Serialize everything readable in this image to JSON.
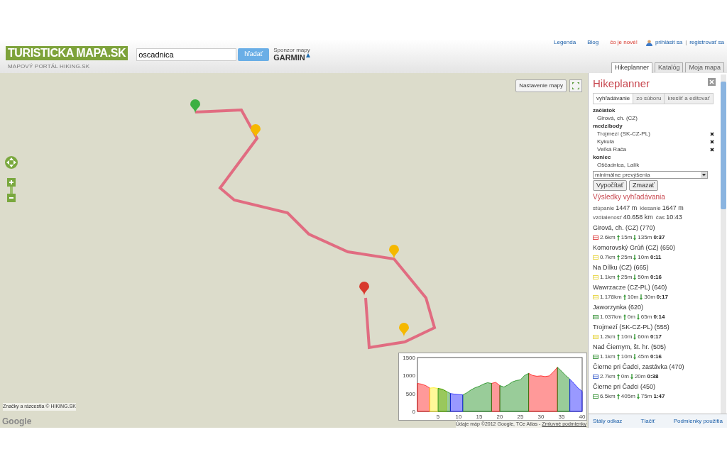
{
  "header": {
    "logo": "TURISTICKA MAPA.SK",
    "tagline": "MAPOVÝ PORTÁL HIKING.SK",
    "search": {
      "value": "oscadnica"
    },
    "search_button": "hľadať",
    "sponsor_label": "Sponzor mapy",
    "sponsor": "GARMIN",
    "links": [
      {
        "label": "Legenda",
        "kind": "plain"
      },
      {
        "label": "Blog",
        "kind": "plain"
      },
      {
        "label": "čo je nové!",
        "kind": "highlight"
      }
    ],
    "login": "prihlásit sa",
    "separator": "|",
    "register": "registrovať sa"
  },
  "tabs": [
    {
      "label": "Hikeplanner",
      "selected": true
    },
    {
      "label": "Katalóg",
      "selected": false
    },
    {
      "label": "Moja mapa",
      "selected": false
    }
  ],
  "map": {
    "settings_button": "Nastavenie mapy",
    "attribution_left": "Značky a rázcestia © HIKING.SK",
    "google": "Google",
    "attribution_right": "Údaje máp ©2012 Google, TCe Atlas - ",
    "terms_link": "Zmluvné podmienky",
    "markers": [
      {
        "color": "#3cb043"
      },
      {
        "color": "#f5b800"
      },
      {
        "color": "#f5b800"
      },
      {
        "color": "#d83a2e"
      },
      {
        "color": "#f5b800"
      }
    ],
    "chart_data": {
      "type": "area",
      "x": [
        0,
        1,
        2,
        3,
        4,
        5,
        6,
        7,
        8,
        9,
        10,
        11,
        12,
        13,
        14,
        15,
        16,
        17,
        18,
        19,
        20,
        21,
        22,
        23,
        24,
        25,
        26,
        27,
        28,
        29,
        30,
        31,
        32,
        33,
        34,
        35,
        36,
        37,
        38,
        39,
        40
      ],
      "xlim": [
        0,
        40
      ],
      "ylim": [
        0,
        1500
      ],
      "xticks": [
        5,
        10,
        15,
        20,
        25,
        30,
        35,
        40
      ],
      "yticks": [
        0,
        500,
        1000,
        1500
      ],
      "series": [
        {
          "color": "#ff0000",
          "values": [
            780,
            760,
            720,
            650,
            null,
            null,
            null,
            null,
            null,
            null,
            null,
            null,
            null,
            null,
            null,
            null,
            null,
            null,
            780,
            810,
            720,
            null,
            null,
            null,
            null,
            null,
            null,
            1060,
            1000,
            980,
            990,
            970,
            990,
            1100,
            1230,
            null,
            null,
            null,
            null,
            null,
            null
          ]
        },
        {
          "color": "#ffee00",
          "values": [
            null,
            null,
            null,
            650,
            660,
            640,
            620,
            560,
            null,
            null,
            null,
            null,
            null,
            null,
            null,
            null,
            null,
            null,
            null,
            null,
            null,
            null,
            null,
            null,
            null,
            null,
            null,
            null,
            null,
            null,
            null,
            null,
            null,
            null,
            null,
            null,
            null,
            null,
            null,
            null,
            null
          ]
        },
        {
          "color": "#008000",
          "values": [
            null,
            null,
            null,
            null,
            null,
            640,
            620,
            560,
            500,
            null,
            null,
            460,
            520,
            600,
            660,
            700,
            760,
            800,
            780,
            null,
            720,
            680,
            740,
            820,
            860,
            880,
            1000,
            1060,
            null,
            null,
            null,
            null,
            null,
            null,
            1230,
            1120,
            1000,
            900,
            null,
            null,
            null
          ]
        },
        {
          "color": "#0000ff",
          "values": [
            null,
            null,
            null,
            null,
            null,
            null,
            null,
            null,
            500,
            480,
            470,
            460,
            null,
            null,
            null,
            null,
            null,
            null,
            null,
            null,
            null,
            null,
            null,
            null,
            null,
            null,
            null,
            null,
            null,
            null,
            null,
            null,
            null,
            null,
            null,
            null,
            null,
            900,
            780,
            650,
            560
          ]
        }
      ]
    }
  },
  "planner": {
    "title": "Hikeplanner",
    "subtabs": [
      {
        "label": "vyhľadávanie",
        "selected": true
      },
      {
        "label": "zo súboru",
        "selected": false
      },
      {
        "label": "kresliť a editovať",
        "selected": false
      }
    ],
    "start_label": "začiatok",
    "start": "Girová, ch. (CZ)",
    "waypoints_label": "medzibody",
    "waypoints": [
      "Trojmezí (SK-CZ-PL)",
      "Kykula",
      "Veľká Rača"
    ],
    "end_label": "koniec",
    "end": "Oščadnica, Lalík",
    "mode": "minimálne prevýšenia",
    "calculate": "Vypočítať",
    "clear": "Zmazať",
    "results_title": "Výsledky vyhľadávania",
    "stats": [
      [
        {
          "label": "stúpanie",
          "value": "1447 m"
        },
        {
          "label": "klesanie",
          "value": "1647 m"
        }
      ],
      [
        {
          "label": "vzdialenosť",
          "value": "40.658 km"
        },
        {
          "label": "čas",
          "value": "10:43"
        }
      ]
    ],
    "legs": [
      {
        "name": "Girová, ch. (CZ) (770)",
        "color": "#e05050",
        "distance": "2.6km",
        "ascent": "15m",
        "descent": "135m",
        "time": "0:37"
      },
      {
        "name": "Komorovský Grúň (CZ) (650)",
        "color": "#e8d850",
        "distance": "0.7km",
        "ascent": "25m",
        "descent": "10m",
        "time": "0:11"
      },
      {
        "name": "Na Dílku (CZ) (665)",
        "color": "#e8d850",
        "distance": "1.1km",
        "ascent": "25m",
        "descent": "50m",
        "time": "0:16"
      },
      {
        "name": "Wawrzacze (CZ-PL) (640)",
        "color": "#e8d850",
        "distance": "1.178km",
        "ascent": "10m",
        "descent": "30m",
        "time": "0:17"
      },
      {
        "name": "Jaworzynka (620)",
        "color": "#50a050",
        "distance": "1.037km",
        "ascent": "0m",
        "descent": "65m",
        "time": "0:14"
      },
      {
        "name": "Trojmezí (SK-CZ-PL) (555)",
        "color": "#e8d850",
        "distance": "1.2km",
        "ascent": "10m",
        "descent": "60m",
        "time": "0:17"
      },
      {
        "name": "Nad Čiernym, št. hr. (505)",
        "color": "#50a050",
        "distance": "1.1km",
        "ascent": "10m",
        "descent": "45m",
        "time": "0:16"
      },
      {
        "name": "Čierne pri Čadci, zastávka (470)",
        "color": "#5070d0",
        "distance": "2.7km",
        "ascent": "0m",
        "descent": "20m",
        "time": "0:38"
      },
      {
        "name": "Čierne pri Čadci (450)",
        "color": "#50a050",
        "distance": "6.5km",
        "ascent": "405m",
        "descent": "75m",
        "time": "1:47"
      }
    ],
    "footer_links": [
      "Stály odkaz",
      "Tlačiť",
      "Podmienky použitia"
    ]
  }
}
